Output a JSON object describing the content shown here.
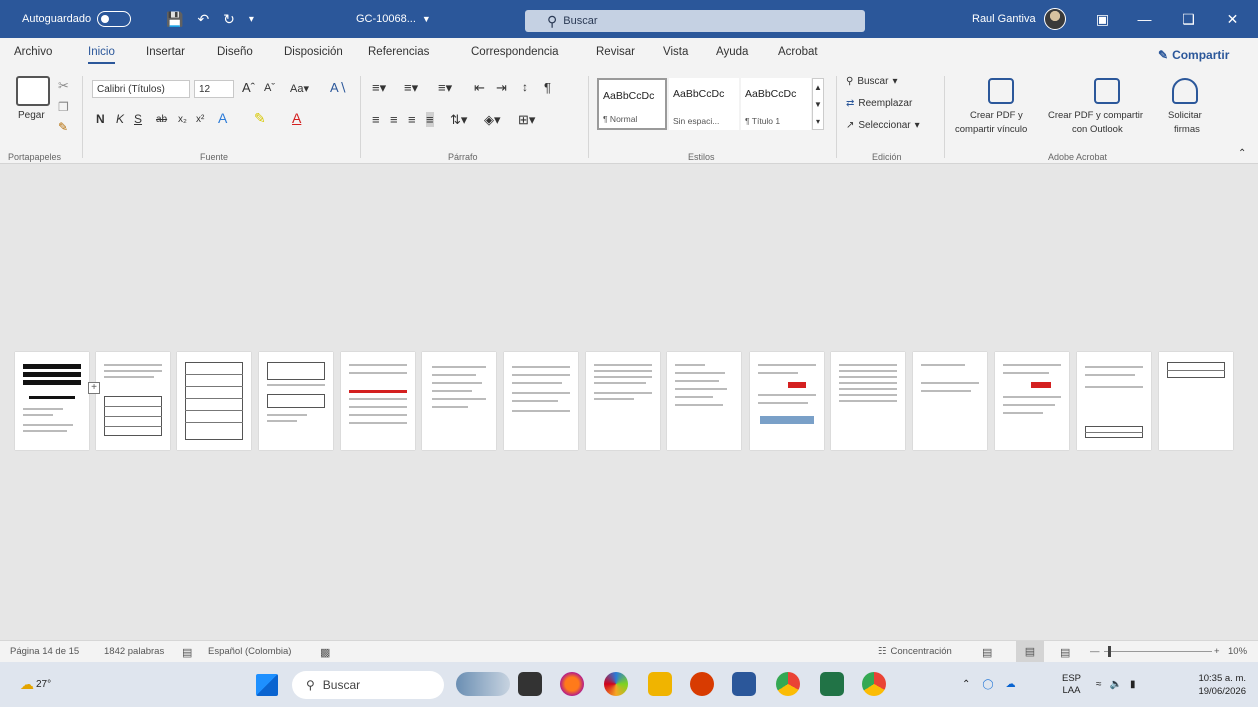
{
  "titlebar": {
    "autosave_label": "Autoguardado",
    "doc_name": "GC-10068...",
    "search_placeholder": "Buscar",
    "user_name": "Raul Gantiva"
  },
  "menu": {
    "items": [
      "Archivo",
      "Inicio",
      "Insertar",
      "Diseño",
      "Disposición",
      "Referencias",
      "Correspondencia",
      "Revisar",
      "Vista",
      "Ayuda",
      "Acrobat"
    ],
    "active": "Inicio",
    "share_label": "Compartir"
  },
  "ribbon": {
    "clipboard": {
      "paste_label": "Pegar",
      "group_label": "Portapapeles"
    },
    "font": {
      "font_name": "Calibri (Títulos)",
      "font_size": "12",
      "group_label": "Fuente",
      "bold": "N",
      "italic": "K",
      "underline": "S"
    },
    "paragraph": {
      "group_label": "Párrafo"
    },
    "styles": {
      "cards": [
        {
          "sample": "AaBbCcDc",
          "name": "¶ Normal"
        },
        {
          "sample": "AaBbCcDc",
          "name": "Sin espaci..."
        },
        {
          "sample": "AaBbCcDc",
          "name": "¶ Título 1"
        }
      ],
      "group_label": "Estilos"
    },
    "editing": {
      "find": "Buscar",
      "replace": "Reemplazar",
      "select": "Seleccionar",
      "group_label": "Edición"
    },
    "acrobat": {
      "btn1_line1": "Crear PDF y",
      "btn1_line2": "compartir vínculo",
      "btn2_line1": "Crear PDF y compartir",
      "btn2_line2": "con Outlook",
      "btn3_line1": "Solicitar",
      "btn3_line2": "firmas",
      "group_label": "Adobe Acrobat"
    }
  },
  "document": {
    "page_count": 15
  },
  "statusbar": {
    "page_info": "Página 14 de 15",
    "word_count": "1842 palabras",
    "language": "Español (Colombia)",
    "focus_label": "Concentración",
    "zoom": "10%"
  },
  "taskbar": {
    "weather_temp": "27°",
    "search_placeholder": "Buscar",
    "lang_line1": "ESP",
    "lang_line2": "LAA",
    "time": "10:35 a. m.",
    "date": "19/06/2026"
  },
  "colors": {
    "accent": "#2b579a",
    "red_block": "#d42020"
  }
}
